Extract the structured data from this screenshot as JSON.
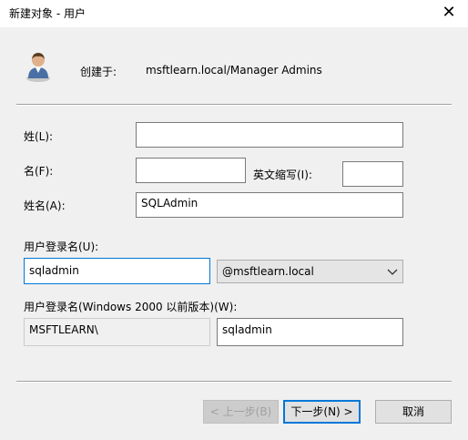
{
  "window": {
    "title": "新建对象 - 用户",
    "close_glyph": "✕"
  },
  "header": {
    "created_in_label": "创建于:",
    "created_in_path": "msftlearn.local/Manager Admins"
  },
  "form": {
    "last_name": {
      "label": "姓(L):",
      "value": ""
    },
    "first_name": {
      "label": "名(F):",
      "value": ""
    },
    "initials": {
      "label": "英文缩写(I):",
      "value": ""
    },
    "full_name": {
      "label": "姓名(A):",
      "value": "SQLAdmin"
    },
    "logon_name": {
      "label": "用户登录名(U):",
      "value": "sqladmin",
      "domain_suffix": "@msftlearn.local"
    },
    "pre2000": {
      "label": "用户登录名(Windows 2000 以前版本)(W):",
      "domain_prefix": "MSFTLEARN\\",
      "value": "sqladmin"
    }
  },
  "buttons": {
    "back": "< 上一步(B)",
    "next": "下一步(N) >",
    "cancel": "取消"
  },
  "icons": {
    "user": "user-icon",
    "close": "close-icon",
    "dropdown": "chevron-down-icon"
  },
  "colors": {
    "focus_border": "#0078d7",
    "dialog_bg": "#f0f0f0"
  }
}
